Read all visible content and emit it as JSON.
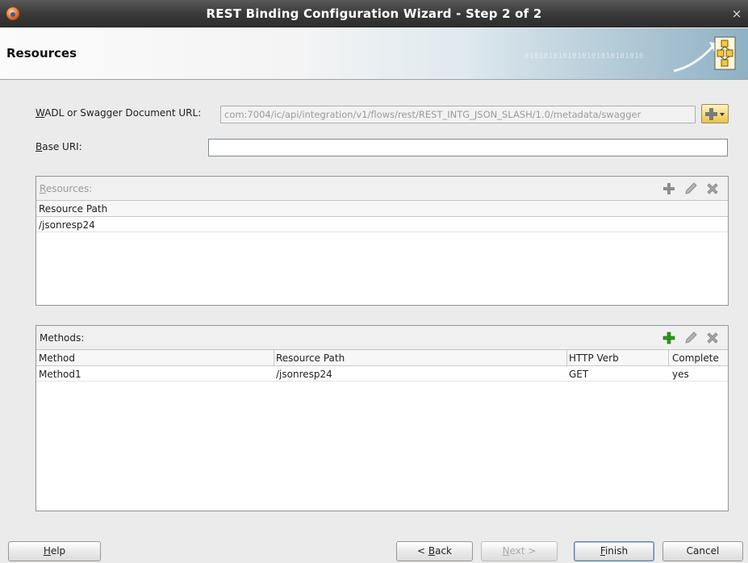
{
  "window": {
    "title": "REST Binding Configuration Wizard - Step 2 of 2",
    "close_glyph": "×"
  },
  "header": {
    "title": "Resources",
    "binary_text": "0101010101010101010101010",
    "icon": "wizard-step-icon"
  },
  "form": {
    "wadl_label_mnemonic": "W",
    "wadl_label_rest": "ADL or Swagger Document URL:",
    "wadl_value": "com:7004/ic/api/integration/v1/flows/rest/REST_INTG_JSON_SLASH/1.0/metadata/swagger",
    "base_uri_label_mnemonic": "B",
    "base_uri_label_rest": "ase URI:",
    "base_uri_value": ""
  },
  "resources_panel": {
    "title_mnemonic": "R",
    "title_rest": "esources:",
    "columns": [
      "Resource Path"
    ],
    "rows": [
      [
        "/jsonresp24"
      ]
    ]
  },
  "methods_panel": {
    "title": "Methods:",
    "columns": [
      "Method",
      "Resource Path",
      "HTTP Verb",
      "Complete"
    ],
    "rows": [
      [
        "Method1",
        "/jsonresp24",
        "GET",
        "yes"
      ]
    ]
  },
  "buttons": {
    "help_mnemonic": "H",
    "help_rest": "elp",
    "back_prefix": "< ",
    "back_mnemonic": "B",
    "back_rest": "ack",
    "next_mnemonic": "N",
    "next_rest": "ext >",
    "finish_mnemonic": "F",
    "finish_rest": "inish",
    "cancel": "Cancel"
  },
  "colors": {
    "titlebar": "#3a3a3a",
    "add_enabled": "#2a9a1a",
    "add_disabled": "#8c8c8c"
  }
}
